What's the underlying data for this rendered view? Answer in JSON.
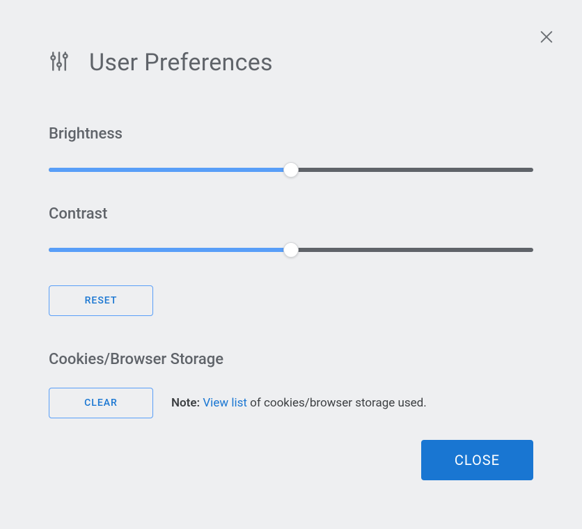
{
  "title": "User Preferences",
  "brightness": {
    "label": "Brightness",
    "value": 50
  },
  "contrast": {
    "label": "Contrast",
    "value": 50
  },
  "buttons": {
    "reset": "RESET",
    "clear": "CLEAR",
    "close": "CLOSE"
  },
  "storage": {
    "label": "Cookies/Browser Storage",
    "note_label": "Note:",
    "view_list": "View list",
    "note_suffix": " of cookies/browser storage used."
  }
}
